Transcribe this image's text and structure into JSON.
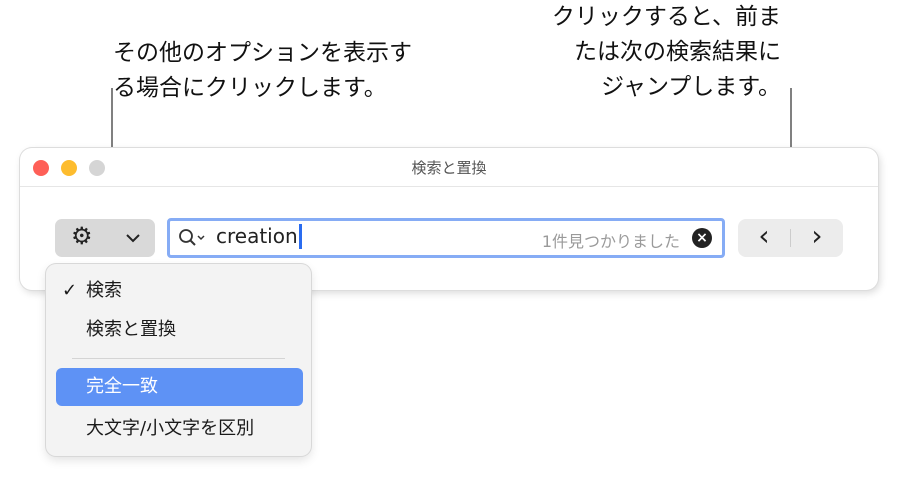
{
  "callouts": {
    "options": [
      "その他のオプションを表示す",
      "る場合にクリックします。"
    ],
    "navigate": [
      "クリックすると、前ま",
      "たは次の検索結果に",
      "ジャンプします。"
    ]
  },
  "window": {
    "title": "検索と置換"
  },
  "search": {
    "value": "creation",
    "result_count": "1件見つかりました"
  },
  "menu": {
    "items": [
      {
        "label": "検索",
        "checked": true
      },
      {
        "label": "検索と置換",
        "checked": false
      },
      {
        "label": "完全一致",
        "highlighted": true
      },
      {
        "label": "大文字/小文字を区別"
      }
    ],
    "checkmark": "✓"
  },
  "icons": {
    "gear": "⚙",
    "chevron": "⌄",
    "prev": "‹",
    "next": "›"
  },
  "colors": {
    "accent": "#5e92f5",
    "focus": "#86acf5",
    "close": "#fe5f57",
    "minimize": "#fdbc2e",
    "zoom": "#d5d5d5"
  }
}
